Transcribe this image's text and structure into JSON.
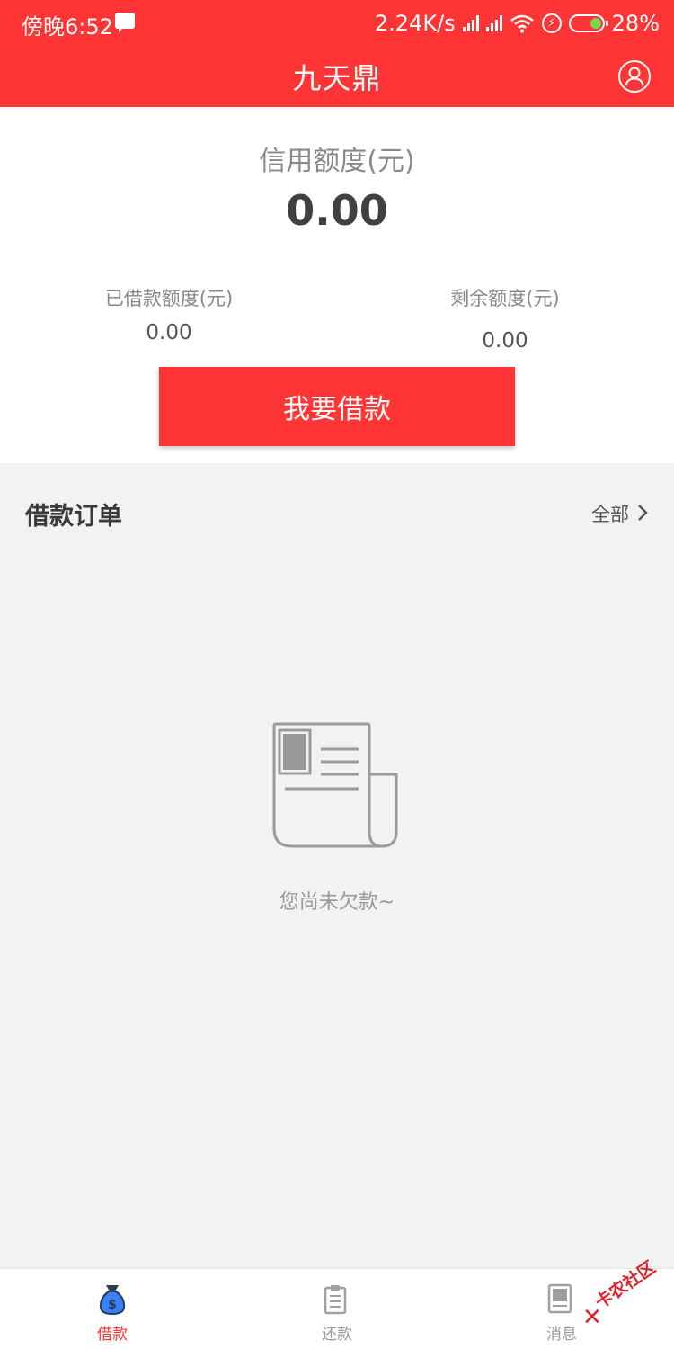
{
  "status_bar": {
    "time": "傍晚6:52",
    "network_speed": "2.24K/s",
    "battery_percent": "28%"
  },
  "header": {
    "title": "九天鼎",
    "icon": "user-profile-icon"
  },
  "summary": {
    "credit_label": "信用额度(元)",
    "credit_value": "0.00",
    "borrowed_label": "已借款额度(元)",
    "borrowed_value": "0.00",
    "remaining_label": "剩余额度(元)",
    "remaining_value": "0.00",
    "borrow_button": "我要借款"
  },
  "orders": {
    "title": "借款订单",
    "view_all": "全部",
    "empty_text": "您尚未欠款~"
  },
  "tabbar": {
    "tabs": [
      {
        "label": "借款",
        "icon": "money-bag-icon",
        "active": true
      },
      {
        "label": "还款",
        "icon": "clipboard-icon",
        "active": false
      },
      {
        "label": "消息",
        "icon": "message-icon",
        "active": false
      }
    ]
  },
  "watermark": {
    "text": "卡农社区"
  },
  "colors": {
    "accent": "#ff3535",
    "background": "#f1f2f2",
    "active_tab_icon": "#3b82f6"
  }
}
